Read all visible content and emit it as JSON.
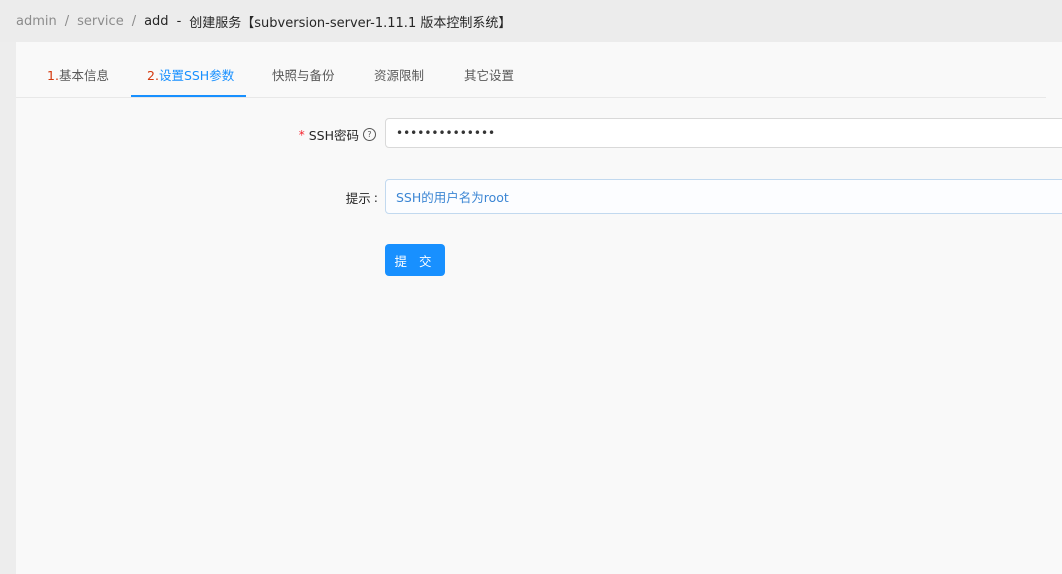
{
  "breadcrumb": {
    "items": [
      "admin",
      "service"
    ],
    "current": "add",
    "title": "创建服务【subversion-server-1.11.1 版本控制系统】"
  },
  "tabs": [
    {
      "num": "1.",
      "label": "基本信息"
    },
    {
      "num": "2.",
      "label": "设置SSH参数"
    },
    {
      "num": "",
      "label": "快照与备份"
    },
    {
      "num": "",
      "label": "资源限制"
    },
    {
      "num": "",
      "label": "其它设置"
    }
  ],
  "form": {
    "ssh_password": {
      "label": "SSH密码",
      "required_mark": "*",
      "help_icon": "?",
      "value": "••••••••••••••"
    },
    "hint": {
      "label": "提示",
      "colon": ":",
      "value": "SSH的用户名为root"
    },
    "submit_label": "提 交"
  },
  "colors": {
    "accent": "#1890ff",
    "required": "#f5222d",
    "step_number": "#d4380d"
  }
}
